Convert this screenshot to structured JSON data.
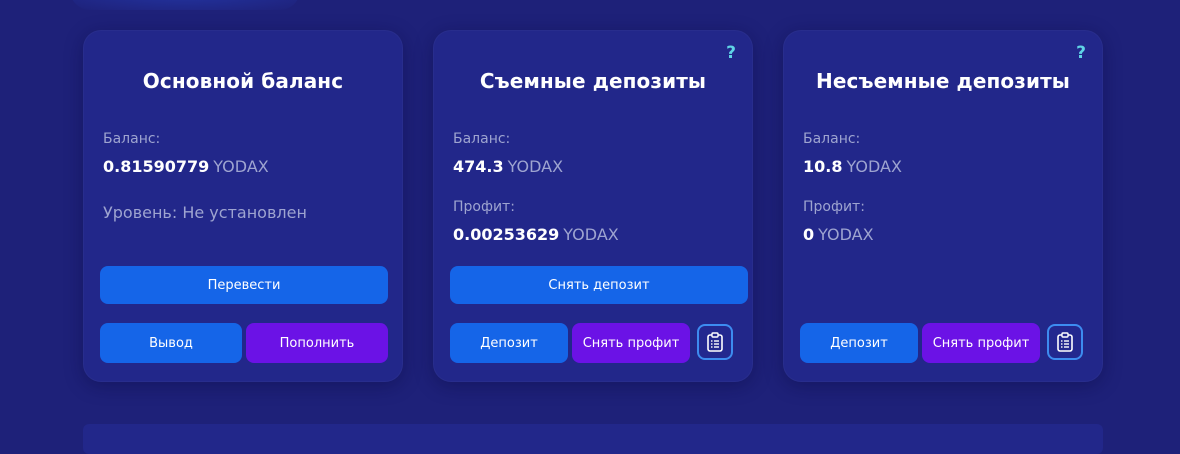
{
  "cards": [
    {
      "title": "Основной баланс",
      "balance_label": "Баланс:",
      "balance_value": "0.81590779",
      "balance_unit": "YODAX",
      "level_text": "Уровень: Не установлен",
      "btn_transfer": "Перевести",
      "btn_withdraw": "Вывод",
      "btn_topup": "Пополнить"
    },
    {
      "title": "Съемные депозиты",
      "help": "?",
      "balance_label": "Баланс:",
      "balance_value": "474.3",
      "balance_unit": "YODAX",
      "profit_label": "Профит:",
      "profit_value": "0.00253629",
      "profit_unit": "YODAX",
      "btn_withdraw_deposit": "Снять депозит",
      "btn_deposit": "Депозит",
      "btn_withdraw_profit": "Снять профит",
      "icon": "clipboard-icon"
    },
    {
      "title": "Несъемные депозиты",
      "help": "?",
      "balance_label": "Баланс:",
      "balance_value": "10.8",
      "balance_unit": "YODAX",
      "profit_label": "Профит:",
      "profit_value": "0",
      "profit_unit": "YODAX",
      "btn_deposit": "Депозит",
      "btn_withdraw_profit": "Снять профит",
      "icon": "clipboard-icon"
    }
  ],
  "colors": {
    "background": "#1e2179",
    "card": "#22278a",
    "button_blue": "#1565e8",
    "button_purple": "#6b12e6",
    "help_icon": "#5fd3e6",
    "muted_text": "#9ea4d0"
  }
}
